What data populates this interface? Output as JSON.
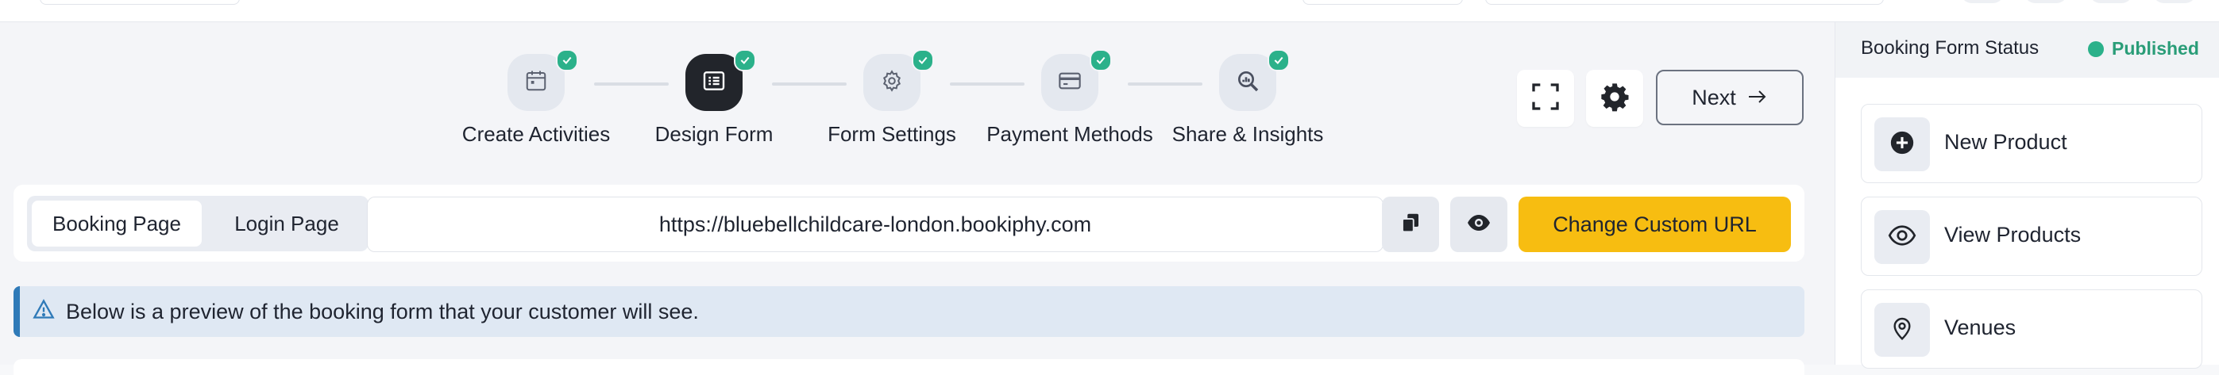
{
  "stepper": {
    "steps": [
      {
        "label": "Create Activities",
        "icon": "calendar-icon",
        "completed": true,
        "active": false
      },
      {
        "label": "Design Form",
        "icon": "form-list-icon",
        "completed": true,
        "active": true
      },
      {
        "label": "Form Settings",
        "icon": "gear-icon",
        "completed": true,
        "active": false
      },
      {
        "label": "Payment Methods",
        "icon": "credit-card-icon",
        "completed": true,
        "active": false
      },
      {
        "label": "Share & Insights",
        "icon": "search-chart-icon",
        "completed": true,
        "active": false
      }
    ]
  },
  "actions": {
    "fullscreen_icon": "fullscreen-icon",
    "settings_icon": "gear-icon",
    "next_label": "Next",
    "next_icon": "arrow-right-icon"
  },
  "url_bar": {
    "tabs": [
      "Booking Page",
      "Login Page"
    ],
    "selected_tab": "Booking Page",
    "url": "https://bluebellchildcare-london.bookiphy.com",
    "copy_icon": "copy-icon",
    "preview_icon": "eye-icon",
    "custom_url_label": "Change Custom URL"
  },
  "banner": {
    "icon": "warning-icon",
    "text": "Below is a preview of the booking form that your customer will see."
  },
  "sidebar": {
    "title": "Booking Form Status",
    "status": "Published",
    "items": [
      {
        "label": "New Product",
        "icon": "plus-circle-icon"
      },
      {
        "label": "View Products",
        "icon": "eye-icon"
      },
      {
        "label": "Venues",
        "icon": "map-pin-icon"
      }
    ]
  },
  "colors": {
    "accent": "#f7bd11",
    "success": "#2bb18a",
    "info": "#2f7ab8",
    "dark": "#22252b"
  }
}
